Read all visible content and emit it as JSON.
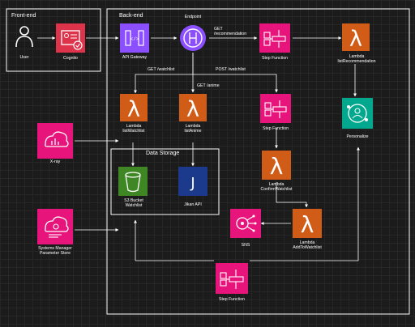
{
  "groups": {
    "frontend": "Front-end",
    "backend": "Back-end",
    "data_storage": "Data Storage"
  },
  "nodes": {
    "user": "User",
    "cognito": "Cognito",
    "api_gateway": "API Gateway",
    "endpoint": "Endpoint",
    "step_function_rec": "Step Function",
    "lambda_list_recommendation": "Lambda listRecommendation",
    "lambda_list_watchlist": "Lambda listWatchlist",
    "lambda_list_anime": "Lambda listAnime",
    "step_function_post": "Step Function",
    "personalize": "Personalize",
    "xray": "X-ray",
    "s3_watchlist": "S3 Bucket Watchlist",
    "jikan_api": "Jikan API",
    "lambda_confirm_watchlist": "Lambda ConfirmWatchlist",
    "sns": "SNS",
    "lambda_add_to_watchlist": "Lambda AddToWatchlist",
    "systems_manager": "Systems Manager Parameter Store",
    "step_function_bottom": "Step Function"
  },
  "edges": {
    "get_recommendation": "GET /recommendation",
    "get_watchlist": "GET /watchlist",
    "post_watchlist": "POST /watchlist",
    "get_anime": "GET /anime"
  },
  "colors": {
    "lambda": "#d05c17",
    "step_function": "#e7157b",
    "network": "#8c4fff",
    "security": "#dd344c",
    "ml": "#01a88d",
    "storage": "#3f8624",
    "jikan": "#1b3a8c"
  }
}
